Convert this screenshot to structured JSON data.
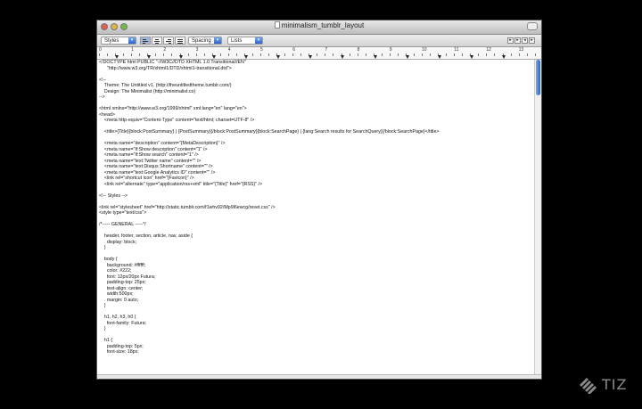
{
  "window": {
    "title": "minimalism_tumblr_layout"
  },
  "toolbar": {
    "styles_label": "Styles",
    "spacing_label": "Spacing",
    "lists_label": "Lists",
    "arrow_glyph": "▾",
    "prev_glyph": "◂",
    "next_glyph": "▸"
  },
  "ruler": {
    "numbers": [
      "0",
      "1",
      "2",
      "3",
      "4",
      "5",
      "6",
      "7",
      "8",
      "9",
      "10",
      "11",
      "12",
      "13"
    ]
  },
  "document": {
    "lines": [
      "<!DOCTYPE html PUBLIC \"-//W3C//DTD XHTML 1.0 Transitional//EN\"",
      "      \"http://www.w3.org/TR/xhtml1/DTD/xhtml1-transitional.dtd\">",
      "",
      "<!--",
      "    Theme: The Untitled v1. (http://theuntitledtheme.tumblr.com/)",
      "    Design: The Minimalist (http://minimalist.co)",
      "-->",
      "",
      "<html xmlns=\"http://www.w3.org/1999/xhtml\" xml:lang=\"en\" lang=\"en\">",
      "<head>",
      "    <meta http-equiv=\"Content-Type\" content=\"text/html; charset=UTF-8\" />",
      "",
      "    <title>{Title}{block:PostSummary} | {PostSummary}{/block:PostSummary}{block:SearchPage} | {lang:Search results for SearchQuery}{/block:SearchPage}</title>",
      "",
      "    <meta name=\"description\" content=\"{MetaDescription}\" />",
      "    <meta name=\"if:Show description\" content=\"1\" />",
      "    <meta name=\"if:Show search\" content=\"1\" />",
      "    <meta name=\"text:Twitter name\" content=\"\" />",
      "    <meta name=\"text:Disqus Shortname\" content=\"\" />",
      "    <meta name=\"text:Google Analytics ID\" content=\"\" />",
      "    <link rel=\"shortcut icon\" href=\"{Favicon}\" />",
      "    <link rel=\"alternate\" type=\"application/rss+xml\" title=\"{Title}\" href=\"{RSS}\" />",
      "",
      "<!-- Styles -->",
      "",
      "<link rel=\"stylesheet\" href=\"http://static.tumblr.com/f1whv92/Mp9l6ewcg/reset.css\" />",
      "<style type=\"text/css\">",
      "",
      "/*----- GENERAL -----*/",
      "",
      "    header, footer, section, article, nav, aside {",
      "      display: block;",
      "    }",
      "",
      "    body {",
      "      background: #ffffff;",
      "      color: #222;",
      "      font: 12px/20px Futura;",
      "      padding-top: 25px;",
      "      text-align: center;",
      "      width:500px;",
      "      margin: 0 auto;",
      "    }",
      "",
      "    h1, h2, h3, h0 {",
      "      font-family: Futura;",
      "    }",
      "",
      "    h1 {",
      "      padding-top: 5px;",
      "      font-size: 18px;"
    ]
  },
  "watermark": {
    "text": "TIZ"
  },
  "colors": {
    "background": "#000000",
    "scroll_accent": "#2a64d0",
    "brand_gray": "#8a8a8a"
  }
}
